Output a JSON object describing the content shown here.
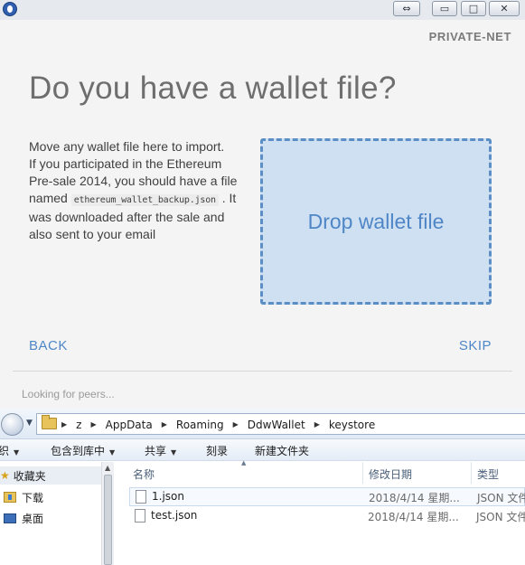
{
  "window": {
    "titlebar_buttons": {
      "resize": "⇔",
      "minimize": "▭",
      "maximize": "□",
      "close": "✕"
    }
  },
  "header": {
    "network": "PRIVATE-NET"
  },
  "main": {
    "title": "Do you have a wallet file?",
    "intro_before": "Move any wallet file here to import.\nIf you participated in the Ethereum Pre-sale 2014, you should have a file named ",
    "filename": "ethereum_wallet_backup.json",
    "intro_after": " . It was downloaded after the sale and also sent to your email",
    "drop_label": "Drop wallet file"
  },
  "nav": {
    "back": "BACK",
    "skip": "SKIP"
  },
  "footer": {
    "status": "Looking for peers..."
  },
  "explorer": {
    "breadcrumb": [
      "z",
      "AppData",
      "Roaming",
      "DdwWallet",
      "keystore"
    ],
    "toolbar": {
      "organize": "织",
      "include_in_library": "包含到库中",
      "share": "共享",
      "burn": "刻录",
      "new_folder": "新建文件夹"
    },
    "sidebar": {
      "favorites": "收藏夹",
      "downloads": "下载",
      "desktop": "桌面"
    },
    "columns": {
      "name": "名称",
      "date_modified": "修改日期",
      "type": "类型"
    },
    "files": [
      {
        "name": "1.json",
        "date": "2018/4/14 星期...",
        "type": "JSON 文件"
      },
      {
        "name": "test.json",
        "date": "2018/4/14 星期...",
        "type": "JSON 文件"
      }
    ]
  },
  "colors": {
    "accent": "#4f86c6",
    "drop_zone_fill": "#cfe0f3",
    "drop_zone_border": "#5b8ec4",
    "title_text": "#6e6e6e"
  }
}
